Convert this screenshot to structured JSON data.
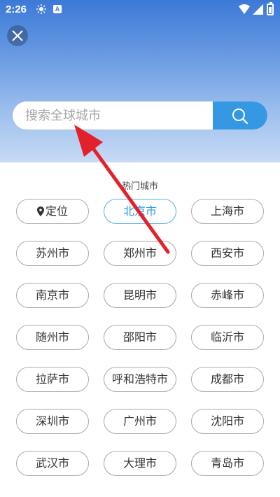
{
  "status_bar": {
    "time": "2:26",
    "icons": [
      "sun-icon",
      "a-icon",
      "wifi-icon",
      "signal-icon",
      "battery-icon"
    ]
  },
  "header": {
    "close_icon": "close-icon"
  },
  "search": {
    "placeholder": "搜索全球城市",
    "button_icon": "search-icon"
  },
  "hot_cities": {
    "title": "热门城市",
    "locate_label": "定位",
    "items": [
      "北京市",
      "上海市",
      "苏州市",
      "郑州市",
      "西安市",
      "南京市",
      "昆明市",
      "赤峰市",
      "随州市",
      "邵阳市",
      "临沂市",
      "拉萨市",
      "呼和浩特市",
      "成都市",
      "深圳市",
      "广州市",
      "沈阳市",
      "武汉市",
      "大理市",
      "青岛市"
    ],
    "selected": "北京市"
  },
  "colors": {
    "accent": "#3598e2",
    "selected_border": "#4eb2f2",
    "arrow": "#e3212b",
    "header_top": "#3c79d7"
  }
}
